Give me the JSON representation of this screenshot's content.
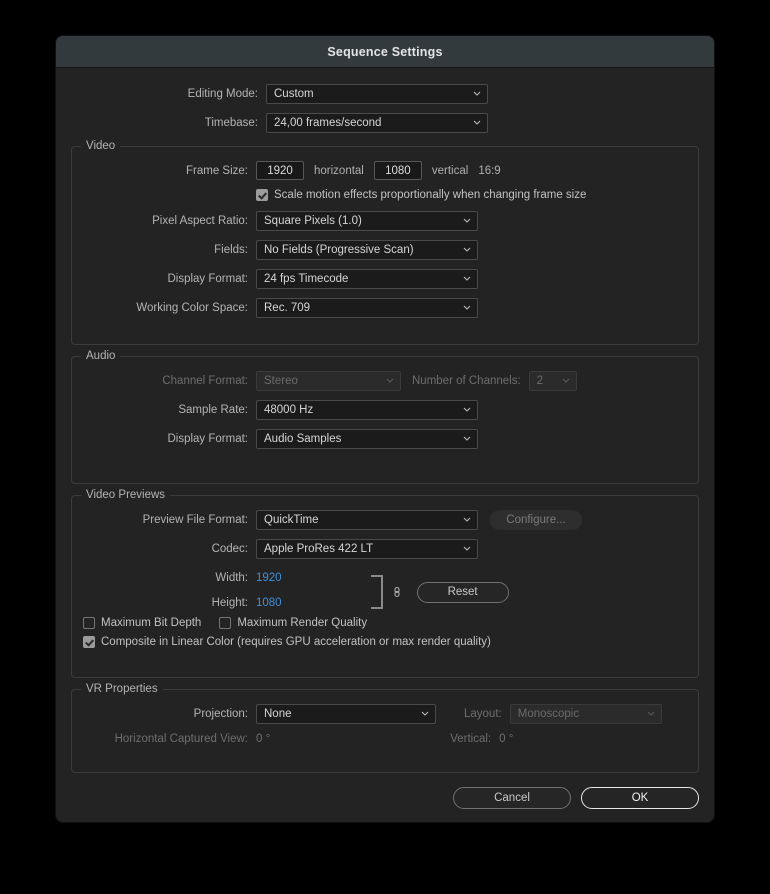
{
  "dialog": {
    "title": "Sequence Settings"
  },
  "top": {
    "editing_mode_label": "Editing Mode:",
    "editing_mode_value": "Custom",
    "timebase_label": "Timebase:",
    "timebase_value": "24,00  frames/second"
  },
  "video": {
    "legend": "Video",
    "frame_size_label": "Frame Size:",
    "frame_width_value": "1920",
    "horizontal_label": "horizontal",
    "frame_height_value": "1080",
    "vertical_label": "vertical",
    "aspect_ratio_text": "16:9",
    "scale_motion_label": "Scale motion effects proportionally when changing frame size",
    "scale_motion_checked": true,
    "pixel_aspect_label": "Pixel Aspect Ratio:",
    "pixel_aspect_value": "Square Pixels (1.0)",
    "fields_label": "Fields:",
    "fields_value": "No Fields (Progressive Scan)",
    "display_format_label": "Display Format:",
    "display_format_value": "24 fps Timecode",
    "working_color_space_label": "Working Color Space:",
    "working_color_space_value": "Rec. 709"
  },
  "audio": {
    "legend": "Audio",
    "channel_format_label": "Channel Format:",
    "channel_format_value": "Stereo",
    "number_of_channels_label": "Number of Channels:",
    "number_of_channels_value": "2",
    "sample_rate_label": "Sample Rate:",
    "sample_rate_value": "48000 Hz",
    "display_format_label": "Display Format:",
    "display_format_value": "Audio Samples"
  },
  "video_previews": {
    "legend": "Video Previews",
    "preview_file_format_label": "Preview File Format:",
    "preview_file_format_value": "QuickTime",
    "configure_label": "Configure...",
    "codec_label": "Codec:",
    "codec_value": "Apple ProRes 422 LT",
    "width_label": "Width:",
    "width_value": "1920",
    "height_label": "Height:",
    "height_value": "1080",
    "reset_label": "Reset",
    "max_bit_depth_label": "Maximum Bit Depth",
    "max_bit_depth_checked": false,
    "max_render_quality_label": "Maximum Render Quality",
    "max_render_quality_checked": false,
    "composite_linear_label": "Composite in Linear Color (requires GPU acceleration or max render quality)",
    "composite_linear_checked": true
  },
  "vr": {
    "legend": "VR Properties",
    "projection_label": "Projection:",
    "projection_value": "None",
    "layout_label": "Layout:",
    "layout_value": "Monoscopic",
    "horizontal_captured_label": "Horizontal Captured View:",
    "horizontal_captured_value": "0 °",
    "vertical_label": "Vertical:",
    "vertical_value": "0 °"
  },
  "footer": {
    "cancel_label": "Cancel",
    "ok_label": "OK"
  },
  "colors": {
    "dialog_bg": "#232323",
    "titlebar_bg": "#333a3e",
    "accent_link": "#3f8fd8",
    "page_bg": "#000000"
  }
}
